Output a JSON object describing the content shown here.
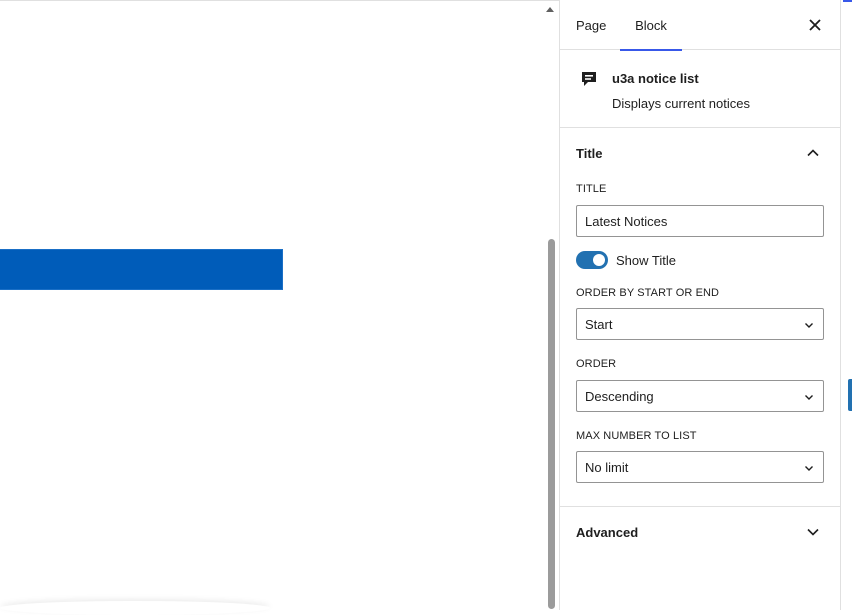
{
  "tabs": {
    "page": "Page",
    "block": "Block"
  },
  "block": {
    "name": "u3a notice list",
    "description": "Displays current notices",
    "icon": "notice-speech-icon"
  },
  "title_panel": {
    "header": "Title",
    "title_label": "TITLE",
    "title_value": "Latest Notices",
    "show_title_label": "Show Title",
    "show_title_on": true,
    "order_by_label": "ORDER BY START OR END",
    "order_by_value": "Start",
    "order_label": "ORDER",
    "order_value": "Descending",
    "max_label": "MAX NUMBER TO LIST",
    "max_value": "No limit"
  },
  "advanced_panel": {
    "header": "Advanced"
  },
  "colors": {
    "accent": "#3858e9",
    "toggle": "#2271b1",
    "canvas_bar": "#005cb9"
  }
}
